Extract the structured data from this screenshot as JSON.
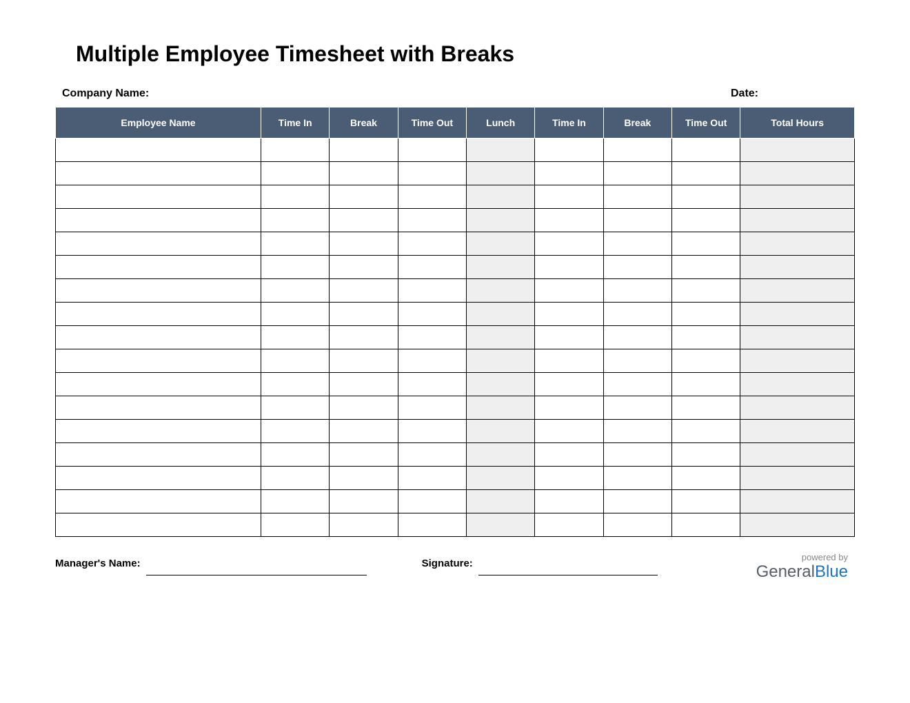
{
  "title": "Multiple Employee Timesheet with Breaks",
  "labels": {
    "company": "Company Name:",
    "date": "Date:",
    "manager": "Manager's Name:",
    "signature": "Signature:"
  },
  "columns": [
    "Employee Name",
    "Time In",
    "Break",
    "Time Out",
    "Lunch",
    "Time In",
    "Break",
    "Time Out",
    "Total Hours"
  ],
  "shaded_columns": [
    4,
    8
  ],
  "row_count": 17,
  "branding": {
    "powered": "powered by",
    "name1": "General",
    "name2": "Blue"
  }
}
